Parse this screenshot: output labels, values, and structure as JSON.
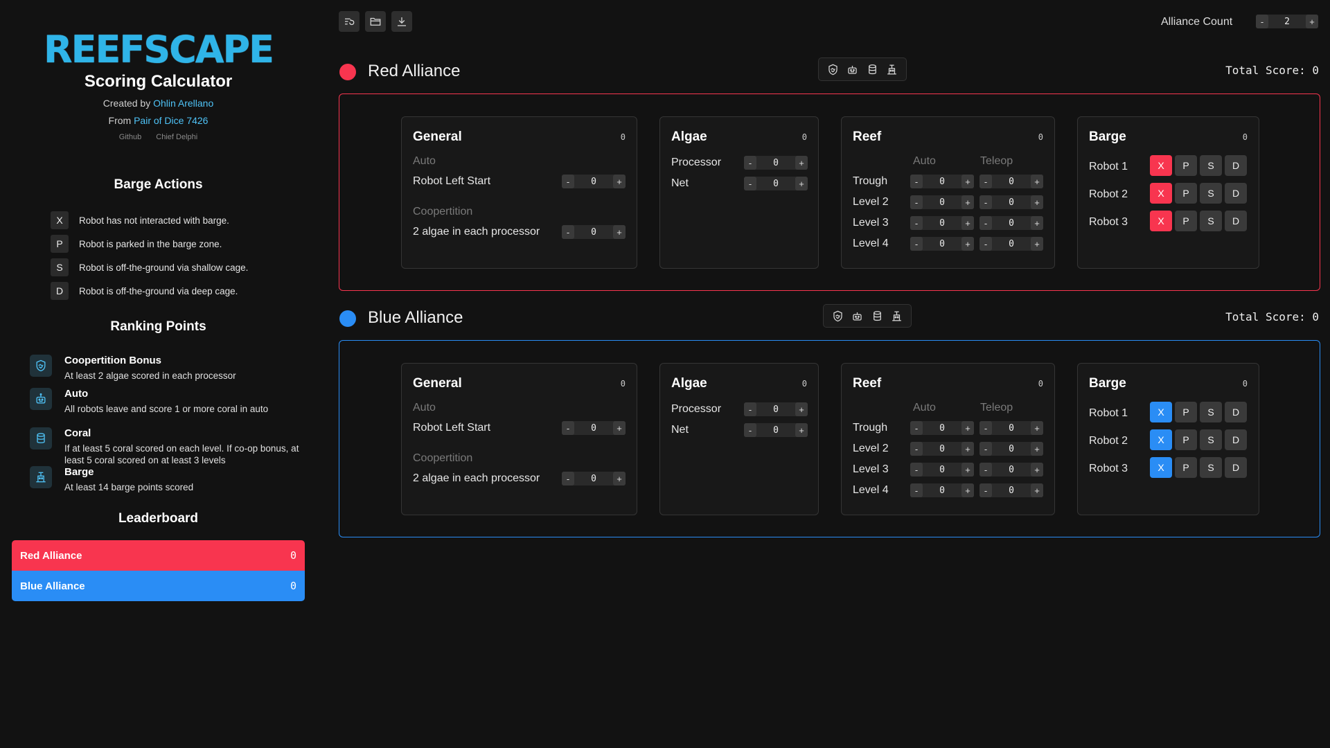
{
  "sidebar": {
    "logo": "REEFSCAPE",
    "title": "Scoring Calculator",
    "created_by_prefix": "Created by ",
    "author": "Ohlin Arellano",
    "from_prefix": "From ",
    "team": "Pair of Dice 7426",
    "link_github": "Github",
    "link_chief": "Chief Delphi",
    "barge_actions_title": "Barge Actions",
    "barge_actions": [
      {
        "key": "X",
        "text": "Robot has not interacted with barge."
      },
      {
        "key": "P",
        "text": "Robot is parked in the barge zone."
      },
      {
        "key": "S",
        "text": "Robot is off-the-ground via shallow cage."
      },
      {
        "key": "D",
        "text": "Robot is off-the-ground via deep cage."
      }
    ],
    "ranking_title": "Ranking Points",
    "ranking_points": [
      {
        "name": "Coopertition Bonus",
        "desc": "At least 2 algae scored in each processor",
        "icon": "handshake-icon"
      },
      {
        "name": "Auto",
        "desc": "All robots leave and score 1 or more coral in auto",
        "icon": "robot-icon"
      },
      {
        "name": "Coral",
        "desc": "If at least 5 coral scored on each level. If co-op bonus, at least 5 coral scored on at least 3 levels",
        "icon": "cylinder-icon"
      },
      {
        "name": "Barge",
        "desc": "At least 14 barge points scored",
        "icon": "robot-climb-icon"
      }
    ],
    "leaderboard_title": "Leaderboard",
    "leaderboard": [
      {
        "name": "Red Alliance",
        "score": "0"
      },
      {
        "name": "Blue Alliance",
        "score": "0"
      }
    ]
  },
  "topbar": {
    "tools": [
      "reset-icon",
      "folder-icon",
      "download-icon"
    ],
    "alliance_count_label": "Alliance Count",
    "alliance_count": "2",
    "minus": "-",
    "plus": "+"
  },
  "colors": {
    "red": "#f8354f",
    "blue": "#2a8df5",
    "accent": "#4fc3f7"
  },
  "alliances": [
    {
      "name": "Red Alliance",
      "total_label": "Total Score: 0",
      "general": {
        "title": "General",
        "score": "0",
        "auto_label": "Auto",
        "left_start_label": "Robot Left Start",
        "left_start": "0",
        "coop_label": "Coopertition",
        "coop_item_label": "2 algae in each processor",
        "coop_item": "0"
      },
      "algae": {
        "title": "Algae",
        "score": "0",
        "processor_label": "Processor",
        "processor": "0",
        "net_label": "Net",
        "net": "0"
      },
      "reef": {
        "title": "Reef",
        "score": "0",
        "auto_label": "Auto",
        "teleop_label": "Teleop",
        "rows": [
          {
            "label": "Trough",
            "auto": "0",
            "teleop": "0"
          },
          {
            "label": "Level 2",
            "auto": "0",
            "teleop": "0"
          },
          {
            "label": "Level 3",
            "auto": "0",
            "teleop": "0"
          },
          {
            "label": "Level 4",
            "auto": "0",
            "teleop": "0"
          }
        ]
      },
      "barge": {
        "title": "Barge",
        "score": "0",
        "robots": [
          "Robot 1",
          "Robot 2",
          "Robot 3"
        ],
        "options": [
          "X",
          "P",
          "S",
          "D"
        ]
      }
    },
    {
      "name": "Blue Alliance",
      "total_label": "Total Score: 0",
      "general": {
        "title": "General",
        "score": "0",
        "auto_label": "Auto",
        "left_start_label": "Robot Left Start",
        "left_start": "0",
        "coop_label": "Coopertition",
        "coop_item_label": "2 algae in each processor",
        "coop_item": "0"
      },
      "algae": {
        "title": "Algae",
        "score": "0",
        "processor_label": "Processor",
        "processor": "0",
        "net_label": "Net",
        "net": "0"
      },
      "reef": {
        "title": "Reef",
        "score": "0",
        "auto_label": "Auto",
        "teleop_label": "Teleop",
        "rows": [
          {
            "label": "Trough",
            "auto": "0",
            "teleop": "0"
          },
          {
            "label": "Level 2",
            "auto": "0",
            "teleop": "0"
          },
          {
            "label": "Level 3",
            "auto": "0",
            "teleop": "0"
          },
          {
            "label": "Level 4",
            "auto": "0",
            "teleop": "0"
          }
        ]
      },
      "barge": {
        "title": "Barge",
        "score": "0",
        "robots": [
          "Robot 1",
          "Robot 2",
          "Robot 3"
        ],
        "options": [
          "X",
          "P",
          "S",
          "D"
        ]
      }
    }
  ]
}
